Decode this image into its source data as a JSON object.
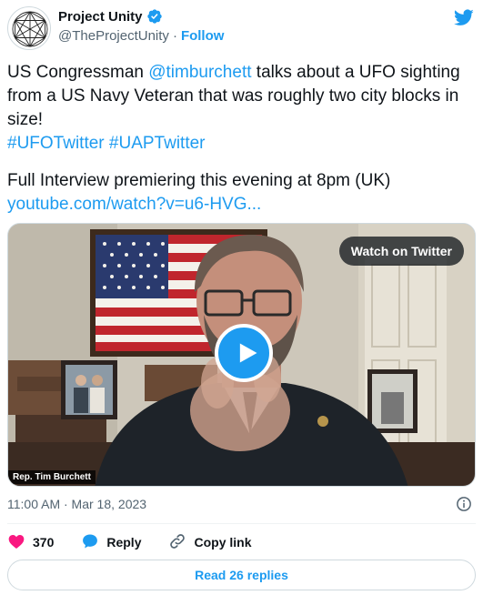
{
  "author": {
    "display_name": "Project Unity",
    "handle": "@TheProjectUnity",
    "separator": "·",
    "follow_label": "Follow",
    "verified": true
  },
  "tweet": {
    "text_before_mention": "US Congressman ",
    "mention": "@timburchett",
    "text_after_mention": "  talks about a UFO sighting from a US Navy Veteran that was roughly two city blocks in size!",
    "hashtag_1": "#UFOTwitter",
    "hashtag_2": "#UAPTwitter",
    "line_interview": "Full Interview premiering this evening at 8pm (UK)",
    "link": "youtube.com/watch?v=u6-HVG..."
  },
  "media": {
    "watch_label": "Watch on Twitter",
    "caption": "Rep. Tim Burchett"
  },
  "meta": {
    "timestamp": "11:00 AM · Mar 18, 2023"
  },
  "actions": {
    "likes_count": "370",
    "reply_label": "Reply",
    "copy_link_label": "Copy link"
  },
  "read_replies_label": "Read 26 replies",
  "colors": {
    "accent": "#1d9bf0",
    "like": "#f91880",
    "muted": "#536471"
  },
  "icons": [
    "globe-network-icon",
    "verified-badge-icon",
    "twitter-bird-icon",
    "play-icon",
    "info-icon",
    "heart-icon",
    "reply-bubble-icon",
    "link-icon"
  ]
}
